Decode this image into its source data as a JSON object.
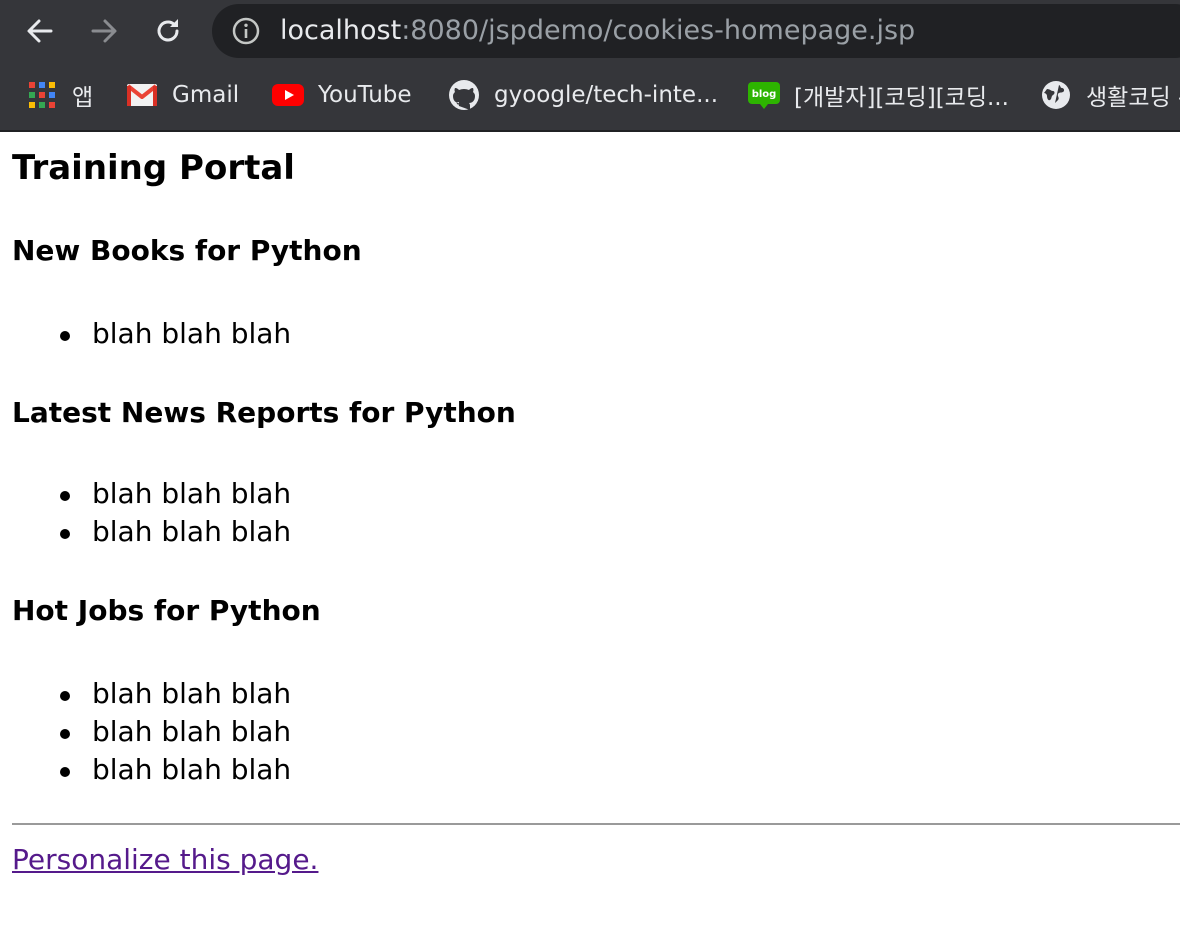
{
  "browser": {
    "url_host": "localhost",
    "url_path": ":8080/jspdemo/cookies-homepage.jsp",
    "bookmarks": [
      {
        "label": "앱",
        "icon": "apps-grid-icon"
      },
      {
        "label": "Gmail",
        "icon": "gmail-icon"
      },
      {
        "label": "YouTube",
        "icon": "youtube-icon"
      },
      {
        "label": "gyoogle/tech-inte...",
        "icon": "github-icon"
      },
      {
        "label": "[개발자][코딩][코딩...",
        "icon": "blog-icon"
      },
      {
        "label": "생활코딩 -",
        "icon": "globe-icon"
      }
    ],
    "icons": {
      "back": "back-arrow-icon",
      "forward": "forward-arrow-icon",
      "reload": "reload-icon",
      "info": "info-icon"
    },
    "colors": {
      "toolbar": "#35363a",
      "omnibox": "#202124",
      "youtube": "#ff0000",
      "blog": "#2db400"
    }
  },
  "page": {
    "title": "Training Portal",
    "sections": [
      {
        "heading": "New Books for Python",
        "items": [
          "blah blah blah"
        ]
      },
      {
        "heading": "Latest News Reports for Python",
        "items": [
          "blah blah blah",
          "blah blah blah"
        ]
      },
      {
        "heading": "Hot Jobs for Python",
        "items": [
          "blah blah blah",
          "blah blah blah",
          "blah blah blah"
        ]
      }
    ],
    "link": "Personalize this page.",
    "link_color": "#551a8b"
  }
}
